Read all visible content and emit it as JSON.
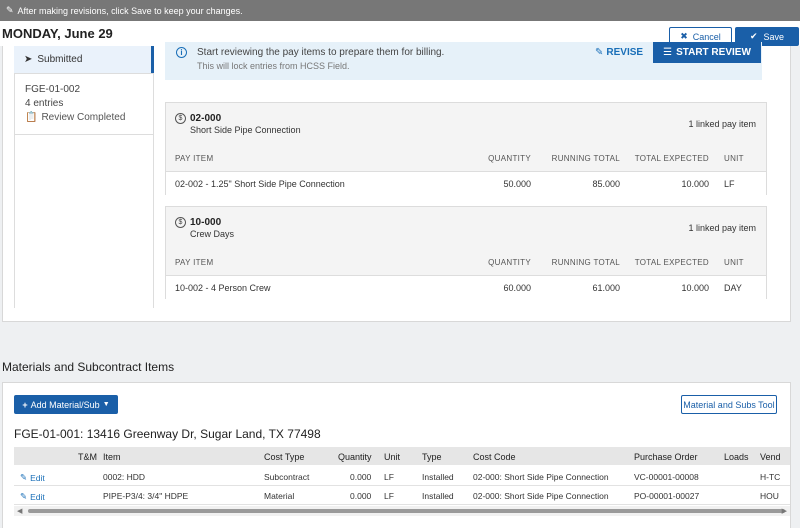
{
  "banner": {
    "text": "After making revisions, click Save to keep your changes.",
    "icon": "pencil-icon"
  },
  "header": {
    "date": "MONDAY, June 29",
    "cancel_label": "Cancel",
    "save_label": "Save"
  },
  "sidebar": {
    "submitted_label": "Submitted",
    "entry_id": "FGE-01-002",
    "entries": "4 entries",
    "review_status": "Review Completed"
  },
  "info": {
    "line1": "Start reviewing the pay items to prepare them for billing.",
    "line2": "This will lock entries from HCSS Field.",
    "revise_label": "REVISE",
    "start_review_label": "START REVIEW"
  },
  "pay_item_cards": [
    {
      "code": "02-000",
      "name": "Short Side Pipe Connection",
      "linked": "1 linked pay item",
      "headers": [
        "PAY ITEM",
        "QUANTITY",
        "RUNNING TOTAL",
        "TOTAL EXPECTED",
        "UNIT"
      ],
      "row": {
        "pay_item": "02-002 - 1.25\" Short Side Pipe Connection",
        "quantity": "50.000",
        "running_total": "85.000",
        "total_expected": "10.000",
        "unit": "LF"
      }
    },
    {
      "code": "10-000",
      "name": "Crew Days",
      "linked": "1 linked pay item",
      "headers": [
        "PAY ITEM",
        "QUANTITY",
        "RUNNING TOTAL",
        "TOTAL EXPECTED",
        "UNIT"
      ],
      "row": {
        "pay_item": "10-002 - 4 Person Crew",
        "quantity": "60.000",
        "running_total": "61.000",
        "total_expected": "10.000",
        "unit": "DAY"
      }
    }
  ],
  "materials": {
    "title": "Materials and Subcontract Items",
    "add_label": "Add Material/Sub",
    "tool_label": "Material and Subs Tool",
    "job": "FGE-01-001: 13416 Greenway Dr, Sugar Land, TX 77498",
    "columns": [
      "T&M",
      "Item",
      "Cost Type",
      "Quantity",
      "Unit",
      "Type",
      "Cost Code",
      "Purchase Order",
      "Loads",
      "Vend"
    ],
    "rows": [
      {
        "edit": "Edit",
        "item": "0002: HDD",
        "cost_type": "Subcontract",
        "quantity": "0.000",
        "unit": "LF",
        "type": "Installed",
        "cost_code": "02-000: Short Side Pipe Connection",
        "po": "VC-00001-00008",
        "loads": "",
        "vendor": "H-TC"
      },
      {
        "edit": "Edit",
        "item": "PIPE-P3/4: 3/4\" HDPE",
        "cost_type": "Material",
        "quantity": "0.000",
        "unit": "LF",
        "type": "Installed",
        "cost_code": "02-000: Short Side Pipe Connection",
        "po": "PO-00001-00027",
        "loads": "",
        "vendor": "HOU"
      }
    ]
  }
}
